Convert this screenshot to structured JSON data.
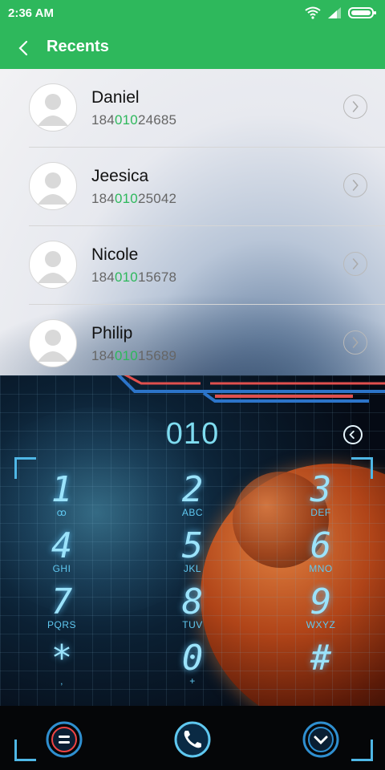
{
  "status_bar": {
    "time": "2:36 AM"
  },
  "header": {
    "title": "Recents"
  },
  "recents": [
    {
      "name": "Daniel",
      "number_prefix": "184",
      "number_match": "010",
      "number_suffix": "24685"
    },
    {
      "name": "Jeesica",
      "number_prefix": "184",
      "number_match": "010",
      "number_suffix": "25042"
    },
    {
      "name": "Nicole",
      "number_prefix": "184",
      "number_match": "010",
      "number_suffix": "15678"
    },
    {
      "name": "Philip",
      "number_prefix": "184",
      "number_match": "010",
      "number_suffix": "15689"
    }
  ],
  "dialer": {
    "display": "010",
    "keys": [
      {
        "digit": "1",
        "letters": "ꝏ"
      },
      {
        "digit": "2",
        "letters": "ABC"
      },
      {
        "digit": "3",
        "letters": "DEF"
      },
      {
        "digit": "4",
        "letters": "GHI"
      },
      {
        "digit": "5",
        "letters": "JKL"
      },
      {
        "digit": "6",
        "letters": "MNO"
      },
      {
        "digit": "7",
        "letters": "PQRS"
      },
      {
        "digit": "8",
        "letters": "TUV"
      },
      {
        "digit": "9",
        "letters": "WXYZ"
      },
      {
        "digit": "*",
        "letters": ","
      },
      {
        "digit": "0",
        "letters": "+"
      },
      {
        "digit": "#",
        "letters": ""
      }
    ]
  },
  "colors": {
    "accent": "#2eb85c",
    "dial_glow": "#7fdcf0"
  },
  "icons": [
    "back-arrow-icon",
    "wifi-icon",
    "signal-icon",
    "battery-icon",
    "chevron-right-icon",
    "backspace-icon",
    "menu-icon",
    "phone-icon",
    "collapse-icon"
  ]
}
